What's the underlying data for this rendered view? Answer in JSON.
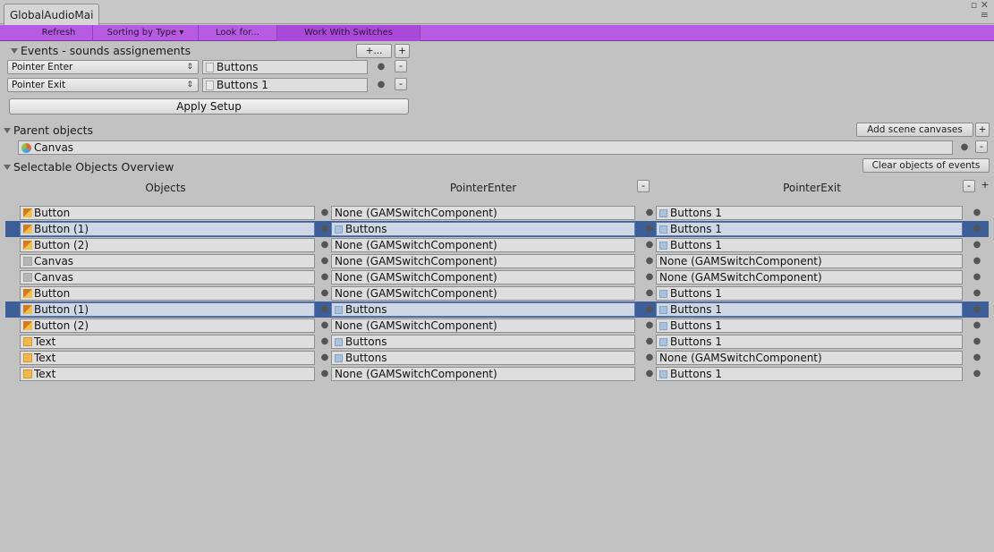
{
  "window": {
    "tab_title": "GlobalAudioMai",
    "controls": "▫ ✕",
    "menu_glyph": "≡"
  },
  "toolbar": {
    "buttons": [
      "Refresh",
      "Sorting by Type",
      "Look for...",
      "Work With Switches"
    ],
    "sorting_arrow": "▾"
  },
  "events_section": {
    "title": "Events - sounds assignements",
    "add_more_label": "+...",
    "add_label": "+",
    "rows": [
      {
        "event": "Pointer Enter",
        "target": "Buttons"
      },
      {
        "event": "Pointer Exit",
        "target": "Buttons 1"
      }
    ],
    "apply_label": "Apply Setup"
  },
  "parent_section": {
    "title": "Parent objects",
    "add_canvases_label": "Add scene canvases",
    "add_label": "+",
    "object": "Canvas"
  },
  "overview_section": {
    "title": "Selectable Objects Overview",
    "clear_label": "Clear objects of events",
    "columns": [
      "Objects",
      "PointerEnter",
      "PointerExit"
    ],
    "minus_label": "-",
    "plus_label": "+",
    "rows": [
      {
        "object": "Button",
        "type": "button",
        "enter": "None (GAMSwitchComponent)",
        "exit": "Buttons 1",
        "selected": false
      },
      {
        "object": "Button (1)",
        "type": "button",
        "enter": "Buttons",
        "exit": "Buttons 1",
        "selected": true
      },
      {
        "object": "Button (2)",
        "type": "button",
        "enter": "None (GAMSwitchComponent)",
        "exit": "Buttons 1",
        "selected": false
      },
      {
        "object": "Canvas",
        "type": "canvas",
        "enter": "None (GAMSwitchComponent)",
        "exit": "None (GAMSwitchComponent)",
        "selected": false
      },
      {
        "object": "Canvas",
        "type": "canvas",
        "enter": "None (GAMSwitchComponent)",
        "exit": "None (GAMSwitchComponent)",
        "selected": false
      },
      {
        "object": "Button",
        "type": "button",
        "enter": "None (GAMSwitchComponent)",
        "exit": "Buttons 1",
        "selected": false
      },
      {
        "object": "Button (1)",
        "type": "button",
        "enter": "Buttons",
        "exit": "Buttons 1",
        "selected": true
      },
      {
        "object": "Button (2)",
        "type": "button",
        "enter": "None (GAMSwitchComponent)",
        "exit": "Buttons 1",
        "selected": false
      },
      {
        "object": "Text",
        "type": "text",
        "enter": "Buttons",
        "exit": "Buttons 1",
        "selected": false
      },
      {
        "object": "Text",
        "type": "text",
        "enter": "Buttons",
        "exit": "None (GAMSwitchComponent)",
        "selected": false
      },
      {
        "object": "Text",
        "type": "text",
        "enter": "None (GAMSwitchComponent)",
        "exit": "Buttons 1",
        "selected": false
      }
    ]
  },
  "colors": {
    "toolbar": "#b65be2",
    "selection": "#3c5f9a",
    "background": "#c2c2c2"
  }
}
